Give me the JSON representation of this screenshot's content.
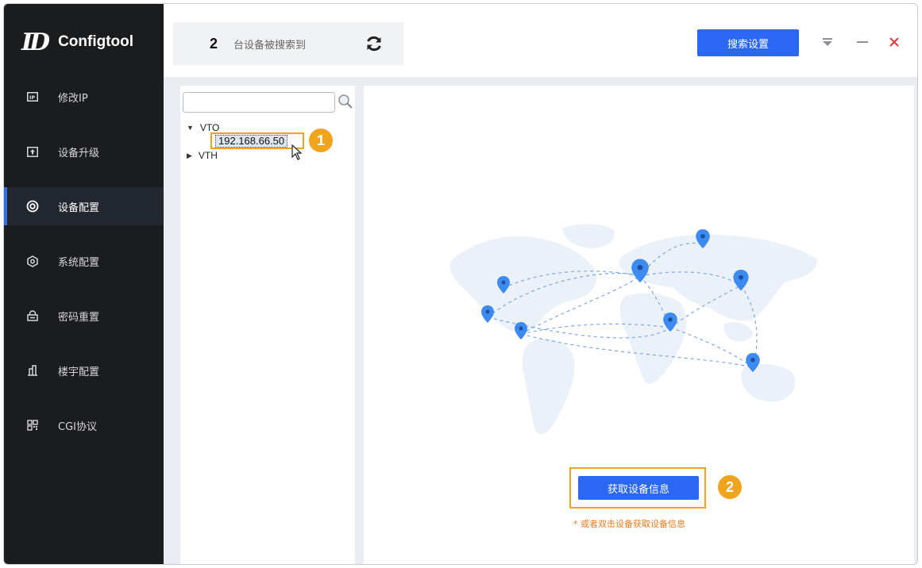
{
  "app": {
    "title": "Configtool",
    "logo_mark": "ID"
  },
  "sidebar": {
    "items": [
      {
        "label": "修改IP",
        "icon": "ip-icon",
        "active": false
      },
      {
        "label": "设备升级",
        "icon": "upgrade-icon",
        "active": false
      },
      {
        "label": "设备配置",
        "icon": "target-icon",
        "active": true
      },
      {
        "label": "系统配置",
        "icon": "hexagon-icon",
        "active": false
      },
      {
        "label": "密码重置",
        "icon": "lock-icon",
        "active": false
      },
      {
        "label": "楼宇配置",
        "icon": "building-icon",
        "active": false
      },
      {
        "label": "CGI协议",
        "icon": "grid-icon",
        "active": false
      }
    ]
  },
  "header": {
    "device_count": "2",
    "device_count_text": "台设备被搜索到",
    "search_settings_label": "搜索设置"
  },
  "tree": {
    "search_placeholder": "",
    "groups": [
      {
        "label": "VTO",
        "expanded": true,
        "children": [
          "192.168.66.50"
        ]
      },
      {
        "label": "VTH",
        "expanded": false,
        "children": []
      }
    ]
  },
  "callouts": {
    "step1": "1",
    "step2": "2"
  },
  "main": {
    "get_info_label": "获取设备信息",
    "hint": "* 或者双击设备获取设备信息"
  },
  "colors": {
    "accent": "#2a67f2",
    "callout": "#f0a41d",
    "hint": "#f27a1a",
    "sidebar_bg": "#1b1c1e"
  }
}
